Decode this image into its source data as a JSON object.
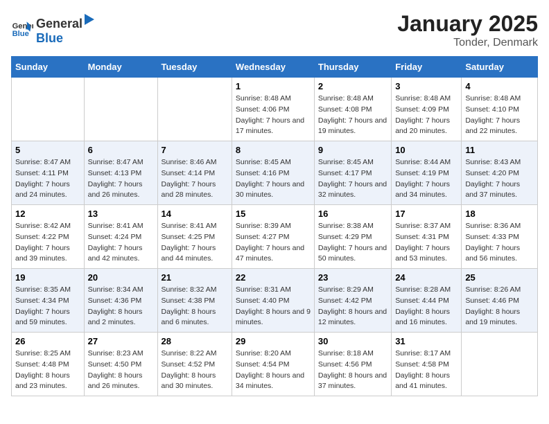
{
  "logo": {
    "general": "General",
    "blue": "Blue"
  },
  "title": "January 2025",
  "subtitle": "Tonder, Denmark",
  "weekdays": [
    "Sunday",
    "Monday",
    "Tuesday",
    "Wednesday",
    "Thursday",
    "Friday",
    "Saturday"
  ],
  "weeks": [
    [
      {
        "day": "",
        "sunrise": "",
        "sunset": "",
        "daylight": ""
      },
      {
        "day": "",
        "sunrise": "",
        "sunset": "",
        "daylight": ""
      },
      {
        "day": "",
        "sunrise": "",
        "sunset": "",
        "daylight": ""
      },
      {
        "day": "1",
        "sunrise": "Sunrise: 8:48 AM",
        "sunset": "Sunset: 4:06 PM",
        "daylight": "Daylight: 7 hours and 17 minutes."
      },
      {
        "day": "2",
        "sunrise": "Sunrise: 8:48 AM",
        "sunset": "Sunset: 4:08 PM",
        "daylight": "Daylight: 7 hours and 19 minutes."
      },
      {
        "day": "3",
        "sunrise": "Sunrise: 8:48 AM",
        "sunset": "Sunset: 4:09 PM",
        "daylight": "Daylight: 7 hours and 20 minutes."
      },
      {
        "day": "4",
        "sunrise": "Sunrise: 8:48 AM",
        "sunset": "Sunset: 4:10 PM",
        "daylight": "Daylight: 7 hours and 22 minutes."
      }
    ],
    [
      {
        "day": "5",
        "sunrise": "Sunrise: 8:47 AM",
        "sunset": "Sunset: 4:11 PM",
        "daylight": "Daylight: 7 hours and 24 minutes."
      },
      {
        "day": "6",
        "sunrise": "Sunrise: 8:47 AM",
        "sunset": "Sunset: 4:13 PM",
        "daylight": "Daylight: 7 hours and 26 minutes."
      },
      {
        "day": "7",
        "sunrise": "Sunrise: 8:46 AM",
        "sunset": "Sunset: 4:14 PM",
        "daylight": "Daylight: 7 hours and 28 minutes."
      },
      {
        "day": "8",
        "sunrise": "Sunrise: 8:45 AM",
        "sunset": "Sunset: 4:16 PM",
        "daylight": "Daylight: 7 hours and 30 minutes."
      },
      {
        "day": "9",
        "sunrise": "Sunrise: 8:45 AM",
        "sunset": "Sunset: 4:17 PM",
        "daylight": "Daylight: 7 hours and 32 minutes."
      },
      {
        "day": "10",
        "sunrise": "Sunrise: 8:44 AM",
        "sunset": "Sunset: 4:19 PM",
        "daylight": "Daylight: 7 hours and 34 minutes."
      },
      {
        "day": "11",
        "sunrise": "Sunrise: 8:43 AM",
        "sunset": "Sunset: 4:20 PM",
        "daylight": "Daylight: 7 hours and 37 minutes."
      }
    ],
    [
      {
        "day": "12",
        "sunrise": "Sunrise: 8:42 AM",
        "sunset": "Sunset: 4:22 PM",
        "daylight": "Daylight: 7 hours and 39 minutes."
      },
      {
        "day": "13",
        "sunrise": "Sunrise: 8:41 AM",
        "sunset": "Sunset: 4:24 PM",
        "daylight": "Daylight: 7 hours and 42 minutes."
      },
      {
        "day": "14",
        "sunrise": "Sunrise: 8:41 AM",
        "sunset": "Sunset: 4:25 PM",
        "daylight": "Daylight: 7 hours and 44 minutes."
      },
      {
        "day": "15",
        "sunrise": "Sunrise: 8:39 AM",
        "sunset": "Sunset: 4:27 PM",
        "daylight": "Daylight: 7 hours and 47 minutes."
      },
      {
        "day": "16",
        "sunrise": "Sunrise: 8:38 AM",
        "sunset": "Sunset: 4:29 PM",
        "daylight": "Daylight: 7 hours and 50 minutes."
      },
      {
        "day": "17",
        "sunrise": "Sunrise: 8:37 AM",
        "sunset": "Sunset: 4:31 PM",
        "daylight": "Daylight: 7 hours and 53 minutes."
      },
      {
        "day": "18",
        "sunrise": "Sunrise: 8:36 AM",
        "sunset": "Sunset: 4:33 PM",
        "daylight": "Daylight: 7 hours and 56 minutes."
      }
    ],
    [
      {
        "day": "19",
        "sunrise": "Sunrise: 8:35 AM",
        "sunset": "Sunset: 4:34 PM",
        "daylight": "Daylight: 7 hours and 59 minutes."
      },
      {
        "day": "20",
        "sunrise": "Sunrise: 8:34 AM",
        "sunset": "Sunset: 4:36 PM",
        "daylight": "Daylight: 8 hours and 2 minutes."
      },
      {
        "day": "21",
        "sunrise": "Sunrise: 8:32 AM",
        "sunset": "Sunset: 4:38 PM",
        "daylight": "Daylight: 8 hours and 6 minutes."
      },
      {
        "day": "22",
        "sunrise": "Sunrise: 8:31 AM",
        "sunset": "Sunset: 4:40 PM",
        "daylight": "Daylight: 8 hours and 9 minutes."
      },
      {
        "day": "23",
        "sunrise": "Sunrise: 8:29 AM",
        "sunset": "Sunset: 4:42 PM",
        "daylight": "Daylight: 8 hours and 12 minutes."
      },
      {
        "day": "24",
        "sunrise": "Sunrise: 8:28 AM",
        "sunset": "Sunset: 4:44 PM",
        "daylight": "Daylight: 8 hours and 16 minutes."
      },
      {
        "day": "25",
        "sunrise": "Sunrise: 8:26 AM",
        "sunset": "Sunset: 4:46 PM",
        "daylight": "Daylight: 8 hours and 19 minutes."
      }
    ],
    [
      {
        "day": "26",
        "sunrise": "Sunrise: 8:25 AM",
        "sunset": "Sunset: 4:48 PM",
        "daylight": "Daylight: 8 hours and 23 minutes."
      },
      {
        "day": "27",
        "sunrise": "Sunrise: 8:23 AM",
        "sunset": "Sunset: 4:50 PM",
        "daylight": "Daylight: 8 hours and 26 minutes."
      },
      {
        "day": "28",
        "sunrise": "Sunrise: 8:22 AM",
        "sunset": "Sunset: 4:52 PM",
        "daylight": "Daylight: 8 hours and 30 minutes."
      },
      {
        "day": "29",
        "sunrise": "Sunrise: 8:20 AM",
        "sunset": "Sunset: 4:54 PM",
        "daylight": "Daylight: 8 hours and 34 minutes."
      },
      {
        "day": "30",
        "sunrise": "Sunrise: 8:18 AM",
        "sunset": "Sunset: 4:56 PM",
        "daylight": "Daylight: 8 hours and 37 minutes."
      },
      {
        "day": "31",
        "sunrise": "Sunrise: 8:17 AM",
        "sunset": "Sunset: 4:58 PM",
        "daylight": "Daylight: 8 hours and 41 minutes."
      },
      {
        "day": "",
        "sunrise": "",
        "sunset": "",
        "daylight": ""
      }
    ]
  ]
}
